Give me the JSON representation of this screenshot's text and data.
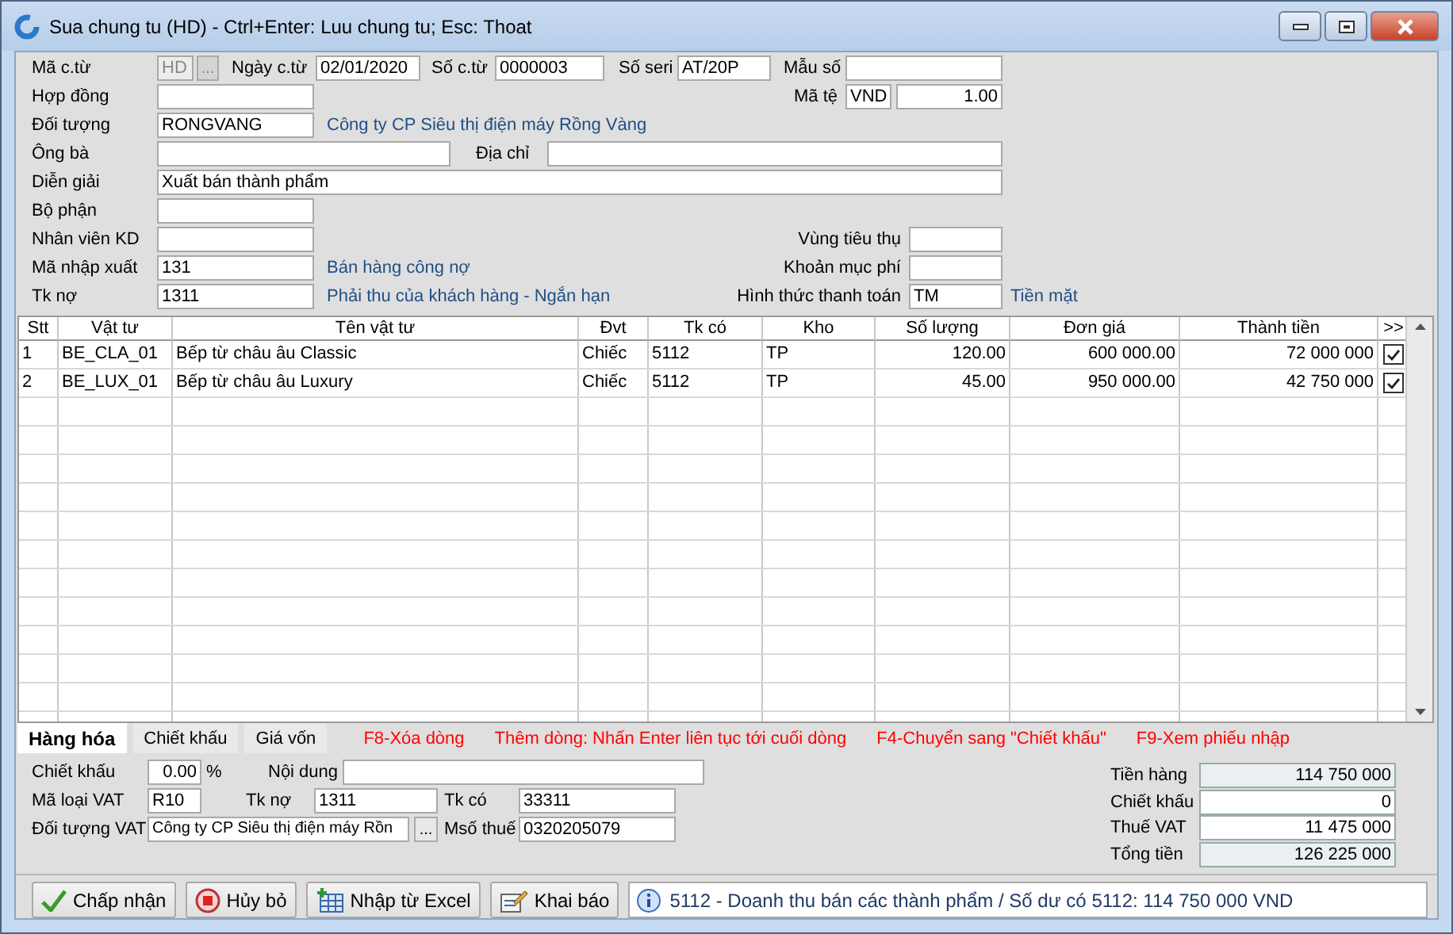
{
  "window": {
    "title": "Sua chung tu (HD) - Ctrl+Enter: Luu chung tu; Esc: Thoat"
  },
  "header": {
    "rows": [
      [
        {
          "kind": "label",
          "text": "Mã c.từ"
        },
        {
          "kind": "field",
          "value": "HD",
          "disabled": true
        },
        {
          "kind": "button",
          "text": "...",
          "disabled": true
        },
        {
          "kind": "label",
          "text": "Ngày c.từ"
        },
        {
          "kind": "field",
          "value": "02/01/2020"
        },
        {
          "kind": "label",
          "text": "Số c.từ"
        },
        {
          "kind": "field",
          "value": "0000003"
        },
        {
          "kind": "label",
          "text": "Số seri"
        },
        {
          "kind": "field",
          "value": "AT/20P"
        },
        {
          "kind": "label",
          "text": "Mẫu số"
        },
        {
          "kind": "field"
        }
      ],
      [
        {
          "kind": "label",
          "text": "Hợp đồng"
        },
        {
          "kind": "field"
        },
        {
          "kind": "label",
          "text": "Mã tệ"
        },
        {
          "kind": "field",
          "value": "VND"
        },
        {
          "kind": "field",
          "value": "1.00"
        }
      ],
      [
        {
          "kind": "label",
          "text": "Đối tượng"
        },
        {
          "kind": "field",
          "value": "RONGVANG"
        },
        {
          "kind": "link",
          "text": "Công ty CP Siêu thị điện máy Rồng Vàng"
        }
      ],
      [
        {
          "kind": "label",
          "text": "Ông bà"
        },
        {
          "kind": "field"
        },
        {
          "kind": "label",
          "text": "Địa chỉ"
        },
        {
          "kind": "field"
        }
      ],
      [
        {
          "kind": "label",
          "text": "Diễn giải"
        },
        {
          "kind": "field",
          "value": "Xuất bán thành phẩm"
        }
      ],
      [
        {
          "kind": "label",
          "text": "Bộ phận"
        },
        {
          "kind": "field"
        }
      ],
      [
        {
          "kind": "label",
          "text": "Nhân viên KD"
        },
        {
          "kind": "field"
        },
        {
          "kind": "label",
          "text": "Vùng tiêu thụ"
        },
        {
          "kind": "field"
        }
      ],
      [
        {
          "kind": "label",
          "text": "Mã nhập xuất"
        },
        {
          "kind": "field",
          "value": "131"
        },
        {
          "kind": "link",
          "text": "Bán hàng công nợ"
        },
        {
          "kind": "label",
          "text": "Khoản mục phí"
        },
        {
          "kind": "field"
        }
      ],
      [
        {
          "kind": "label",
          "text": "Tk nợ"
        },
        {
          "kind": "field",
          "value": "1311"
        },
        {
          "kind": "link",
          "text": "Phải thu của khách hàng - Ngắn hạn"
        },
        {
          "kind": "label",
          "text": "Hình thức thanh toán"
        },
        {
          "kind": "field",
          "value": "TM"
        },
        {
          "kind": "link",
          "text": "Tiền mặt"
        }
      ]
    ]
  },
  "grid": {
    "columns": [
      "Stt",
      "Vật tư",
      "Tên vật tư",
      "Đvt",
      "Tk có",
      "Kho",
      "Số lượng",
      "Đơn giá",
      "Thành tiền",
      ">>"
    ],
    "rows": [
      {
        "cells": [
          "1",
          "BE_CLA_01",
          "Bếp từ châu âu Classic",
          "Chiếc",
          "5112",
          "TP",
          "120.00",
          "600 000.00",
          "72 000 000"
        ],
        "checked": true
      },
      {
        "cells": [
          "2",
          "BE_LUX_01",
          "Bếp từ châu âu Luxury",
          "Chiếc",
          "5112",
          "TP",
          "45.00",
          "950 000.00",
          "42 750 000"
        ],
        "checked": true
      }
    ]
  },
  "tabs": [
    {
      "label": "Hàng hóa",
      "selected": true
    },
    {
      "label": "Chiết khấu",
      "selected": false
    },
    {
      "label": "Giá vốn",
      "selected": false
    }
  ],
  "hints": [
    "F8-Xóa dòng",
    "Thêm dòng: Nhấn Enter liên tục tới cuối dòng",
    "F4-Chuyển sang \"Chiết khấu\"",
    "F9-Xem phiếu nhập"
  ],
  "detail": {
    "fields": [
      {
        "label": "Chiết khấu",
        "value": "0.00",
        "unit": "%"
      },
      {
        "label": "Nội dung"
      },
      {
        "label": "Mã loại VAT",
        "value": "R10"
      },
      {
        "label": "Tk nợ",
        "value": "1311"
      },
      {
        "label": "Tk có",
        "value": "33311"
      },
      {
        "label": "Đối tượng VAT",
        "value": "Công ty CP Siêu thị điện máy Rồn",
        "button": "..."
      },
      {
        "label": "Msố thuế",
        "value": "0320205079"
      }
    ]
  },
  "totals": [
    {
      "label": "Tiền hàng",
      "value": "114 750 000",
      "readonly": true
    },
    {
      "label": "Chiết khấu",
      "value": "0",
      "readonly": false
    },
    {
      "label": "Thuế VAT",
      "value": "11 475 000",
      "readonly": false
    },
    {
      "label": "Tổng tiền",
      "value": "126 225 000",
      "readonly": true
    }
  ],
  "buttons": [
    {
      "label": "Chấp nhận",
      "kind": "accept"
    },
    {
      "label": "Hủy bỏ",
      "kind": "cancel"
    },
    {
      "label": "Nhập từ Excel",
      "kind": "excel"
    },
    {
      "label": "Khai báo",
      "kind": "declare"
    }
  ],
  "status": "5112 - Doanh thu bán các thành phẩm / Số dư có 5112: 114 750 000 VND"
}
